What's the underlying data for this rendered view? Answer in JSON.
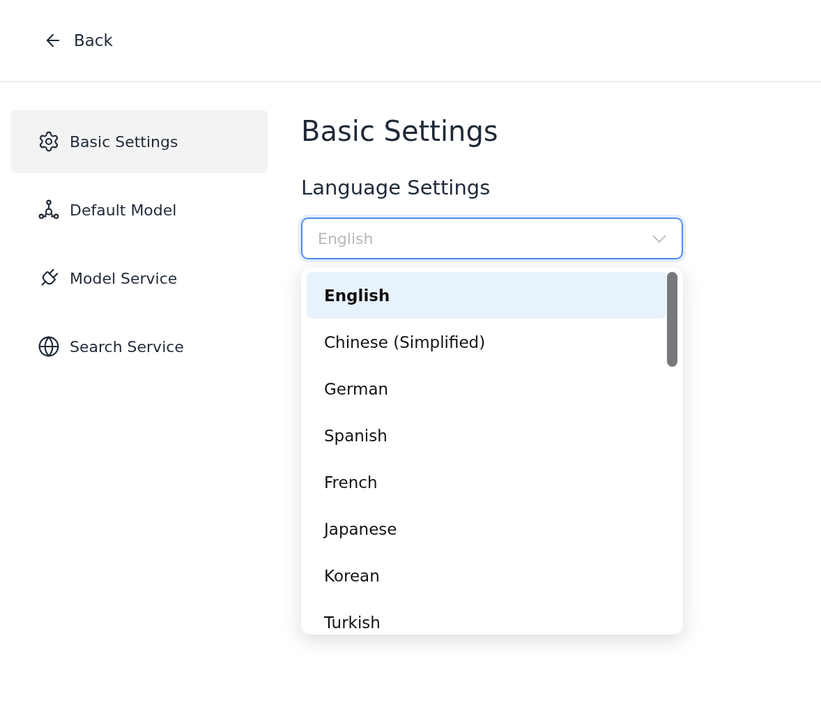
{
  "header": {
    "back_label": "Back"
  },
  "sidebar": {
    "items": [
      {
        "label": "Basic Settings",
        "kind": "gear",
        "selected": true
      },
      {
        "label": "Default Model",
        "kind": "nodes",
        "selected": false
      },
      {
        "label": "Model Service",
        "kind": "plug",
        "selected": false
      },
      {
        "label": "Search Service",
        "kind": "globe",
        "selected": false
      }
    ]
  },
  "content": {
    "title": "Basic Settings",
    "section_title": "Language Settings",
    "language_select": {
      "placeholder": "English",
      "expanded": true,
      "options": [
        {
          "label": "English",
          "selected": true
        },
        {
          "label": "Chinese (Simplified)",
          "selected": false
        },
        {
          "label": "German",
          "selected": false
        },
        {
          "label": "Spanish",
          "selected": false
        },
        {
          "label": "French",
          "selected": false
        },
        {
          "label": "Japanese",
          "selected": false
        },
        {
          "label": "Korean",
          "selected": false
        },
        {
          "label": "Turkish",
          "selected": false
        }
      ]
    }
  }
}
